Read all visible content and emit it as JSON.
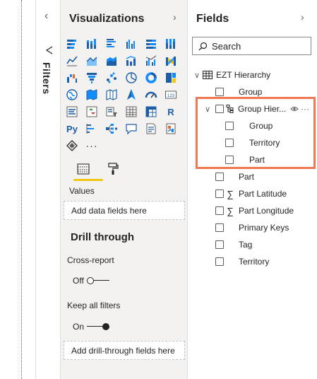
{
  "filters": {
    "label": "Filters"
  },
  "visualizations": {
    "title": "Visualizations",
    "python_label": "Py",
    "r_label": "R",
    "more": "···",
    "values_label": "Values",
    "values_placeholder": "Add data fields here",
    "drill_title": "Drill through",
    "cross_report_label": "Cross-report",
    "cross_report_state": "Off",
    "keep_filters_label": "Keep all filters",
    "keep_filters_state": "On",
    "drill_placeholder": "Add drill-through fields here"
  },
  "fields": {
    "title": "Fields",
    "search_placeholder": "Search",
    "table_name": "EZT Hierarchy",
    "items": {
      "group": "Group",
      "hierarchy": "Group Hier...",
      "hier_group": "Group",
      "hier_territory": "Territory",
      "hier_part": "Part",
      "part": "Part",
      "part_latitude": "Part Latitude",
      "part_longitude": "Part Longitude",
      "primary_keys": "Primary Keys",
      "tag": "Tag",
      "territory": "Territory"
    },
    "hierarchy_more": "···"
  },
  "colors": {
    "highlight": "#f07a55",
    "accent_yellow": "#f2c811",
    "viz_blue": "#1d5fa6",
    "viz_teal": "#118dff"
  }
}
